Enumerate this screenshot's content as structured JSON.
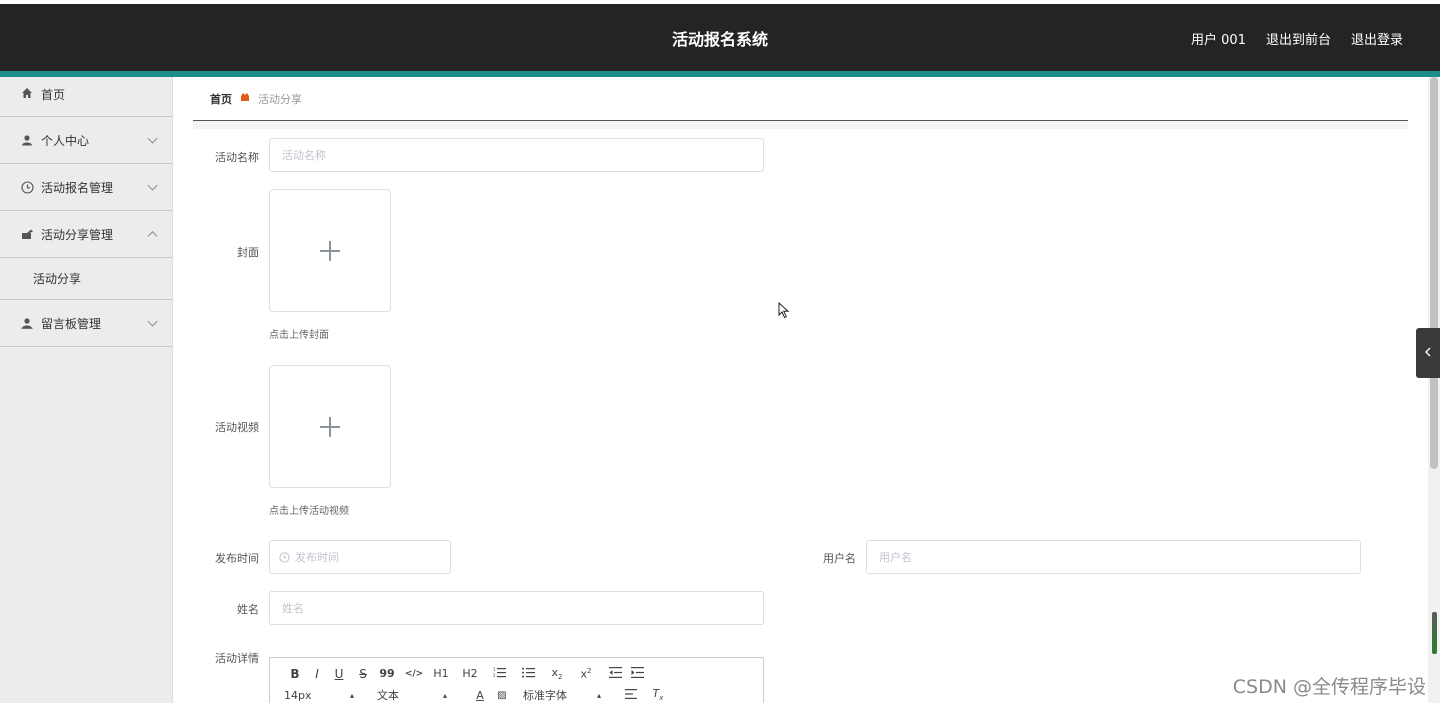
{
  "header": {
    "title": "活动报名系统",
    "user_label": "用户 001",
    "to_front_label": "退出到前台",
    "logout_label": "退出登录"
  },
  "sidebar": {
    "items": [
      {
        "label": "首页",
        "icon": "home-icon"
      },
      {
        "label": "个人中心",
        "icon": "user-icon"
      },
      {
        "label": "活动报名管理",
        "icon": "clock-icon"
      },
      {
        "label": "活动分享管理",
        "icon": "share-icon"
      },
      {
        "label": "留言板管理",
        "icon": "user-icon"
      }
    ],
    "sub_items": [
      {
        "label": "活动分享"
      }
    ]
  },
  "breadcrumb": {
    "home": "首页",
    "current": "活动分享"
  },
  "form": {
    "name_label": "活动名称",
    "name_placeholder": "活动名称",
    "cover_label": "封面",
    "cover_hint": "点击上传封面",
    "video_label": "活动视频",
    "video_hint": "点击上传活动视频",
    "publish_time_label": "发布时间",
    "publish_time_placeholder": "发布时间",
    "username_label": "用户名",
    "username_placeholder": "用户名",
    "realname_label": "姓名",
    "realname_placeholder": "姓名",
    "detail_label": "活动详情"
  },
  "editor": {
    "row1": [
      "B",
      "I",
      "U",
      "S",
      "99",
      "</>",
      "H1",
      "H2",
      "ol",
      "ul",
      "x2",
      "x²",
      "outdent",
      "indent"
    ],
    "size_value": "14px",
    "type_value": "文本",
    "font_value": "标准字体"
  },
  "watermark": "CSDN @全传程序毕设",
  "colors": {
    "header_bg": "#242424",
    "accent": "#1a8f8a",
    "sidebar_bg": "#ececec",
    "breadcrumb_sep": "#e55a1b"
  }
}
